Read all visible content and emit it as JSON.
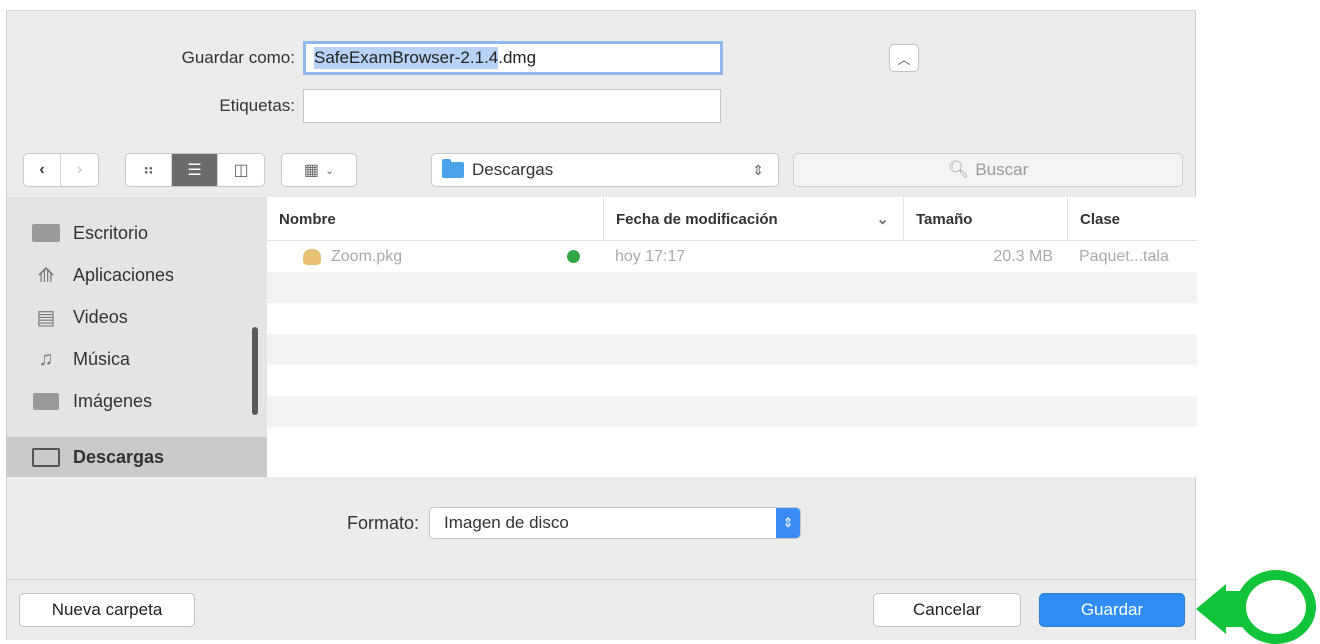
{
  "save_as": {
    "label": "Guardar como:",
    "filename_selected": "SafeExamBrowser-2.1.4",
    "filename_ext": ".dmg",
    "tags_label": "Etiquetas:",
    "tags_value": ""
  },
  "toolbar": {
    "back_icon": "chevron-left-icon",
    "forward_icon": "chevron-right-icon",
    "location": "Descargas",
    "search_placeholder": "Buscar"
  },
  "sidebar": {
    "items": [
      {
        "label": "Escritorio",
        "icon": "desktop-icon"
      },
      {
        "label": "Aplicaciones",
        "icon": "applications-icon"
      },
      {
        "label": "Videos",
        "icon": "film-icon"
      },
      {
        "label": "Música",
        "icon": "music-note-icon"
      },
      {
        "label": "Imágenes",
        "icon": "camera-icon"
      },
      {
        "label": "Descargas",
        "icon": "folder-icon",
        "selected": true
      }
    ]
  },
  "file_list": {
    "columns": [
      "Nombre",
      "Fecha de modificación",
      "Tamaño",
      "Clase"
    ],
    "sort_indicator": "⌄",
    "rows": [
      {
        "name": "Zoom.pkg",
        "date": "hoy 17:17",
        "size": "20.3 MB",
        "kind": "Paquet...tala"
      }
    ]
  },
  "format": {
    "label": "Formato:",
    "value": "Imagen de disco"
  },
  "buttons": {
    "new_folder": "Nueva carpeta",
    "cancel": "Cancelar",
    "save": "Guardar"
  },
  "colors": {
    "accent": "#2f8ef6",
    "annotation": "#12c43a"
  }
}
